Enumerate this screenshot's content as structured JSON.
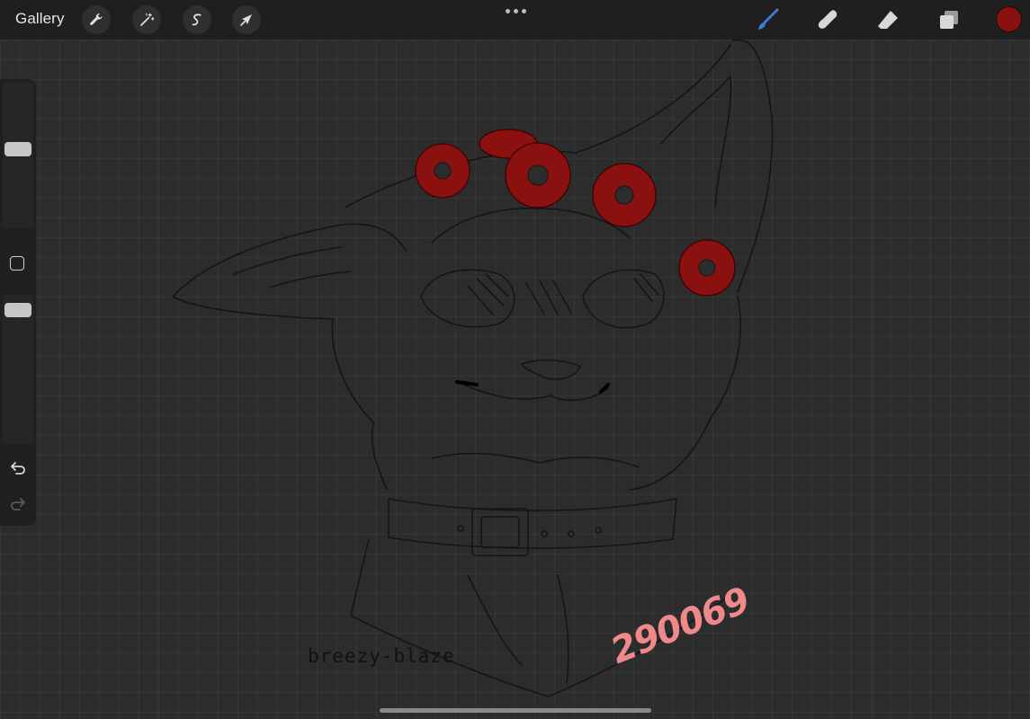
{
  "toolbar": {
    "gallery_label": "Gallery",
    "left_tools": [
      {
        "name": "actions",
        "icon": "wrench-icon"
      },
      {
        "name": "adjustments",
        "icon": "magic-wand-icon"
      },
      {
        "name": "selection",
        "icon": "selection-s-icon"
      },
      {
        "name": "transform",
        "icon": "arrow-cursor-icon"
      }
    ],
    "right_tools": [
      {
        "name": "brush",
        "icon": "brush-icon",
        "active": true
      },
      {
        "name": "smudge",
        "icon": "smudge-icon",
        "active": false
      },
      {
        "name": "eraser",
        "icon": "eraser-icon",
        "active": false
      },
      {
        "name": "layers",
        "icon": "layers-icon",
        "active": false
      }
    ],
    "current_color": "#8b1010",
    "accent_color": "#3a7bd5"
  },
  "sidebar": {
    "brush_size_level": 0.55,
    "opacity_level": 0.95
  },
  "canvas": {
    "signature_text": "breezy-blaze",
    "watermark_text": "290069",
    "watermark_color": "#f08a8a",
    "flower_color": "#8b1010"
  }
}
